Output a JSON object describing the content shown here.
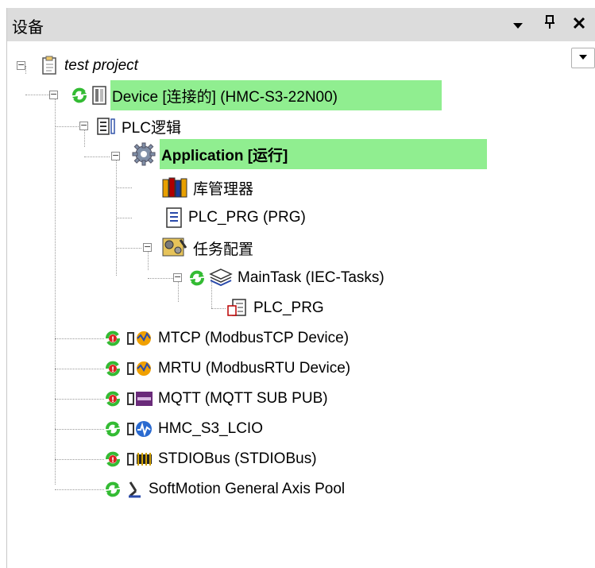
{
  "panel": {
    "title": "设备",
    "buttons": {
      "menu": "▾",
      "pin": "Ⳓ",
      "close": "✕"
    },
    "dropdown": "▾"
  },
  "tree": {
    "project": "test project",
    "device": "Device [连接的] (HMC-S3-22N00)",
    "plc_logic": "PLC逻辑",
    "application": "Application [运行]",
    "library_manager": "库管理器",
    "plc_prg": "PLC_PRG (PRG)",
    "task_config": "任务配置",
    "main_task": "MainTask (IEC-Tasks)",
    "plc_prg_call": "PLC_PRG",
    "mtcp": "MTCP (ModbusTCP Device)",
    "mrtu": "MRTU (ModbusRTU Device)",
    "mqtt": "MQTT (MQTT SUB PUB)",
    "hmc": "HMC_S3_LCIO",
    "stdiobus": "STDIOBus (STDIOBus)",
    "softmotion": "SoftMotion General Axis Pool"
  },
  "colors": {
    "highlight": "#90ee90",
    "running": "#33bb33",
    "error": "#dd2222",
    "titlebar": "#dcdcdc"
  },
  "icons": {
    "project": "project-document-icon",
    "device": "plc-device-icon",
    "plc_logic": "plc-logic-icon",
    "application": "gear-icon",
    "library": "books-icon",
    "prg": "document-icon",
    "task_config": "task-config-icon",
    "task": "task-stack-icon",
    "call": "program-call-icon",
    "sync": "sync-running-icon",
    "warning_sync": "sync-error-icon"
  }
}
